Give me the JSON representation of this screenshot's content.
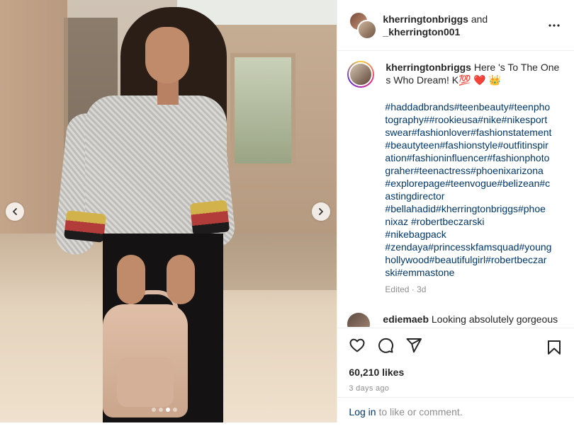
{
  "carousel": {
    "prev_icon": "chevron-left-icon",
    "next_icon": "chevron-right-icon",
    "slide_count": 4,
    "active_slide": 3
  },
  "header": {
    "user1": "kherringtonbriggs",
    "joiner": "and",
    "user2": "_kherrington001",
    "more_icon": "more-horizontal-icon"
  },
  "caption": {
    "username": "kherringtonbriggs",
    "text": "Here 's To The Ones Who Dream! K💯 ❤️ 👑",
    "hashtag_lines": [
      "#haddadbrands#teenbeauty#teenpho",
      "tography##rookieusa#nike#nikesport",
      "swear#fashionlover#fashionstatement",
      "#beautyteen#fashionstyle#outfitinspir",
      "ation#fashioninfluencer#fashionphoto",
      "graher#teenactress#phoenixarizona",
      "#explorepage#teenvogue#belizean#c",
      "astingdirector",
      "#bellahadid#kherringtonbriggs#phoe",
      "nixaz #robertbeczarski",
      "#nikebagpack",
      "#zendaya#princesskfamsquad#young",
      "hollywood#beautifulgirl#robertbeczar",
      "ski#emmastone"
    ],
    "edited": "Edited · 3d"
  },
  "comment": {
    "username": "ediemaeb",
    "text": "Looking absolutely gorgeous"
  },
  "actions": {
    "like_icon": "heart-icon",
    "comment_icon": "comment-icon",
    "share_icon": "share-icon",
    "save_icon": "bookmark-icon",
    "likes": "60,210 likes",
    "ago": "3 days ago",
    "login_link": "Log in",
    "login_rest": " to like or comment."
  },
  "colors": {
    "link": "#00376b",
    "muted": "#8e8e8e",
    "text": "#262626"
  }
}
